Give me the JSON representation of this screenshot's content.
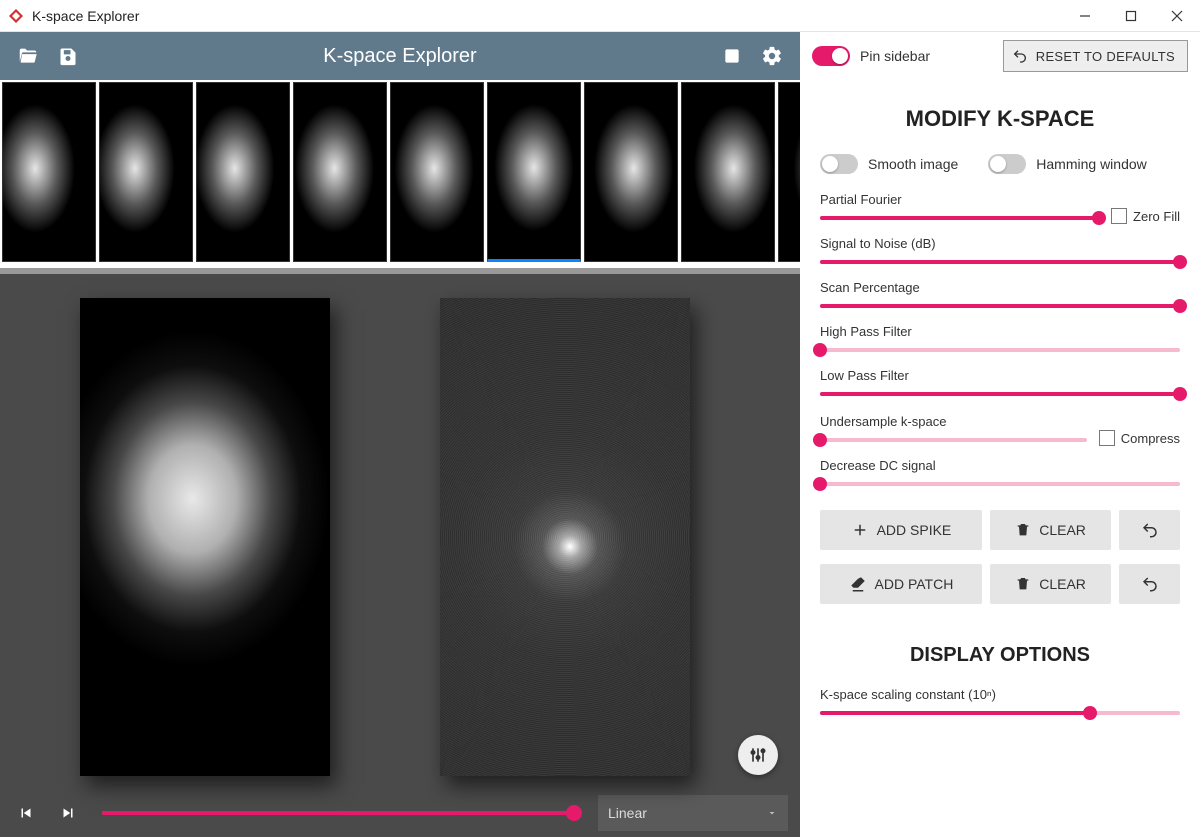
{
  "window": {
    "title": "K-space Explorer"
  },
  "toolbar": {
    "title": "K-space Explorer"
  },
  "thumbnails": {
    "count": 9,
    "selected_index": 5
  },
  "playbar": {
    "scale_mode": "Linear",
    "progress_pct": 100
  },
  "sidebar": {
    "pin_label": "Pin sidebar",
    "pin_on": true,
    "reset_label": "RESET TO DEFAULTS",
    "section_title": "MODIFY K-SPACE",
    "smooth_label": "Smooth image",
    "smooth_on": false,
    "hamming_label": "Hamming window",
    "hamming_on": false,
    "sliders": {
      "partial_fourier": {
        "label": "Partial Fourier",
        "pct": 100,
        "checkbox_label": "Zero Fill"
      },
      "snr": {
        "label": "Signal to Noise (dB)",
        "pct": 100
      },
      "scan_pct": {
        "label": "Scan Percentage",
        "pct": 100
      },
      "highpass": {
        "label": "High Pass Filter",
        "pct": 0
      },
      "lowpass": {
        "label": "Low Pass Filter",
        "pct": 100
      },
      "undersample": {
        "label": "Undersample k-space",
        "pct": 0,
        "checkbox_label": "Compress"
      },
      "dc": {
        "label": "Decrease DC signal",
        "pct": 0
      }
    },
    "buttons": {
      "add_spike": "ADD SPIKE",
      "add_patch": "ADD PATCH",
      "clear": "CLEAR"
    },
    "display_title": "DISPLAY OPTIONS",
    "kspace_scale": {
      "label": "K-space scaling constant (10ⁿ)",
      "pct": 75
    }
  }
}
